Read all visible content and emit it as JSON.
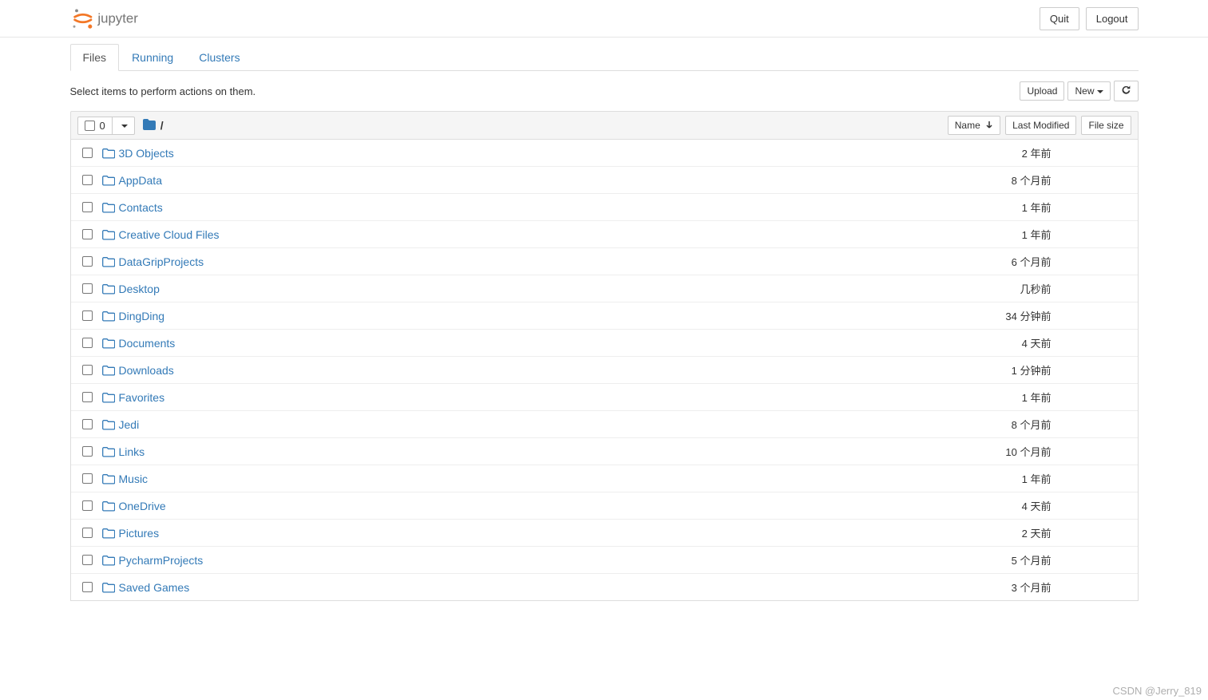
{
  "header": {
    "logo_text": "jupyter",
    "quit": "Quit",
    "logout": "Logout"
  },
  "tabs": [
    {
      "label": "Files",
      "active": true
    },
    {
      "label": "Running",
      "active": false
    },
    {
      "label": "Clusters",
      "active": false
    }
  ],
  "toolbar": {
    "select_text": "Select items to perform actions on them.",
    "upload": "Upload",
    "new": "New",
    "select_count": "0",
    "breadcrumb_root": "/"
  },
  "columns": {
    "name": "Name",
    "last_modified": "Last Modified",
    "file_size": "File size"
  },
  "files": [
    {
      "name": "3D Objects",
      "modified": "2 年前"
    },
    {
      "name": "AppData",
      "modified": "8 个月前"
    },
    {
      "name": "Contacts",
      "modified": "1 年前"
    },
    {
      "name": "Creative Cloud Files",
      "modified": "1 年前"
    },
    {
      "name": "DataGripProjects",
      "modified": "6 个月前"
    },
    {
      "name": "Desktop",
      "modified": "几秒前"
    },
    {
      "name": "DingDing",
      "modified": "34 分钟前"
    },
    {
      "name": "Documents",
      "modified": "4 天前"
    },
    {
      "name": "Downloads",
      "modified": "1 分钟前"
    },
    {
      "name": "Favorites",
      "modified": "1 年前"
    },
    {
      "name": "Jedi",
      "modified": "8 个月前"
    },
    {
      "name": "Links",
      "modified": "10 个月前"
    },
    {
      "name": "Music",
      "modified": "1 年前"
    },
    {
      "name": "OneDrive",
      "modified": "4 天前"
    },
    {
      "name": "Pictures",
      "modified": "2 天前"
    },
    {
      "name": "PycharmProjects",
      "modified": "5 个月前"
    },
    {
      "name": "Saved Games",
      "modified": "3 个月前"
    }
  ],
  "watermark": "CSDN @Jerry_819"
}
